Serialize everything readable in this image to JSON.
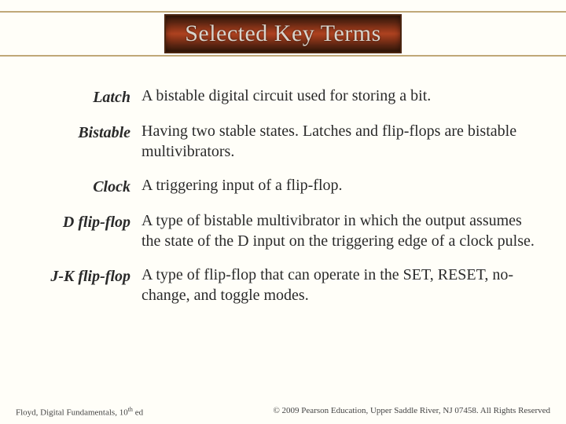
{
  "title": "Selected Key Terms",
  "terms": [
    {
      "label": "Latch",
      "definition": "A bistable digital circuit used for storing a bit."
    },
    {
      "label": "Bistable",
      "definition": "Having two stable states. Latches and flip-flops are bistable multivibrators."
    },
    {
      "label": "Clock",
      "definition": "A triggering input of a flip-flop."
    },
    {
      "label": "D flip-flop",
      "definition": "A type of bistable multivibrator in which the output assumes the state of the D input on the triggering edge of a clock pulse."
    },
    {
      "label": "J-K flip-flop",
      "definition": "A type of flip-flop that can operate in the SET, RESET, no-change, and toggle modes."
    }
  ],
  "footer": {
    "left_prefix": "Floyd, Digital Fundamentals, 10",
    "left_sup": "th",
    "left_suffix": " ed",
    "right": "© 2009 Pearson Education, Upper Saddle River, NJ 07458. All Rights Reserved"
  }
}
